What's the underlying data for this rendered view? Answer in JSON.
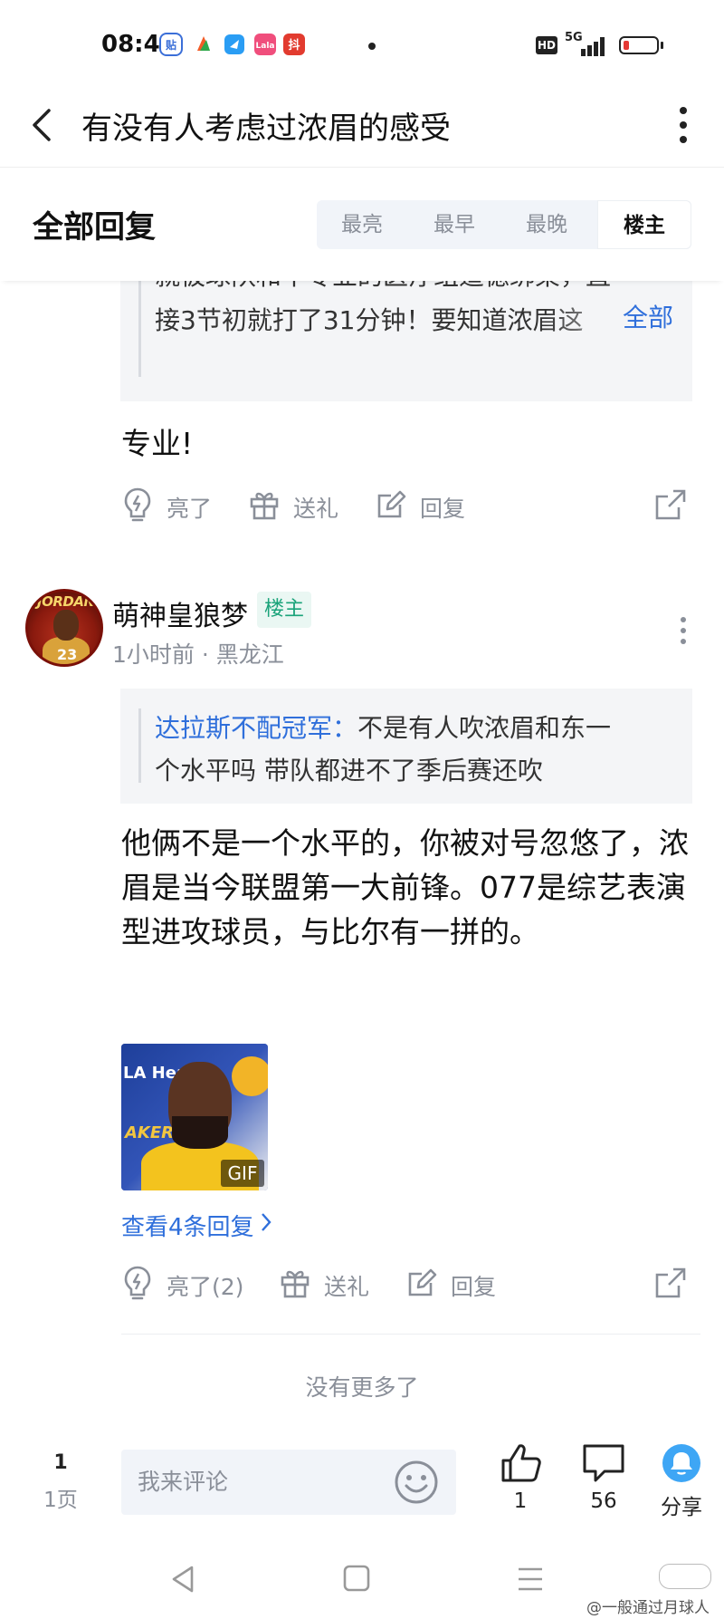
{
  "status_bar": {
    "time": "08:40",
    "hd": "HD",
    "network": "5G"
  },
  "header": {
    "title": "有没有人考虑过浓眉的感受"
  },
  "replies_header": {
    "title": "全部回复",
    "sort_tabs": [
      {
        "label": "最亮",
        "active": false
      },
      {
        "label": "最早",
        "active": false
      },
      {
        "label": "最晚",
        "active": false
      },
      {
        "label": "楼主",
        "active": true
      }
    ]
  },
  "reply1": {
    "quote_line1": "就被球队和不专业的医疗组道德绑架，直",
    "quote_line2": "接3节初就打了31分钟！要知道浓眉这",
    "quote_more": "全部",
    "text": "专业!",
    "actions": {
      "light": "亮了",
      "gift": "送礼",
      "reply": "回复"
    }
  },
  "reply2": {
    "author": "萌神皇狼梦",
    "avatar_label": "JORDAN",
    "avatar_number": "23",
    "badge": "楼主",
    "meta": "1小时前 · 黑龙江",
    "quote_user": "达拉斯不配冠军：",
    "quote_line1_rest": "不是有人吹浓眉和东一",
    "quote_line2": "个水平吗 带队都进不了季后赛还吹",
    "text": "他俩不是一个水平的，你被对号忽悠了，浓眉是当今联盟第一大前锋。077是综艺表演型进攻球员，与比尔有一拼的。",
    "gif_badge": "GIF",
    "gif_text1": "LA Healt",
    "gif_text2": "AKERS",
    "view_replies": "查看4条回复",
    "actions": {
      "light": "亮了(2)",
      "gift": "送礼",
      "reply": "回复"
    }
  },
  "no_more": "没有更多了",
  "bottom_bar": {
    "page_number": "1",
    "page_label": "1页",
    "comment_placeholder": "我来评论",
    "likes": "1",
    "comments": "56",
    "share": "分享"
  },
  "watermark": "@一般通过月球人",
  "colors": {
    "accent_blue": "#2f6fdb",
    "op_green": "#1aa37a",
    "share_blue": "#3ea6f5",
    "battery_red": "#e53935"
  }
}
